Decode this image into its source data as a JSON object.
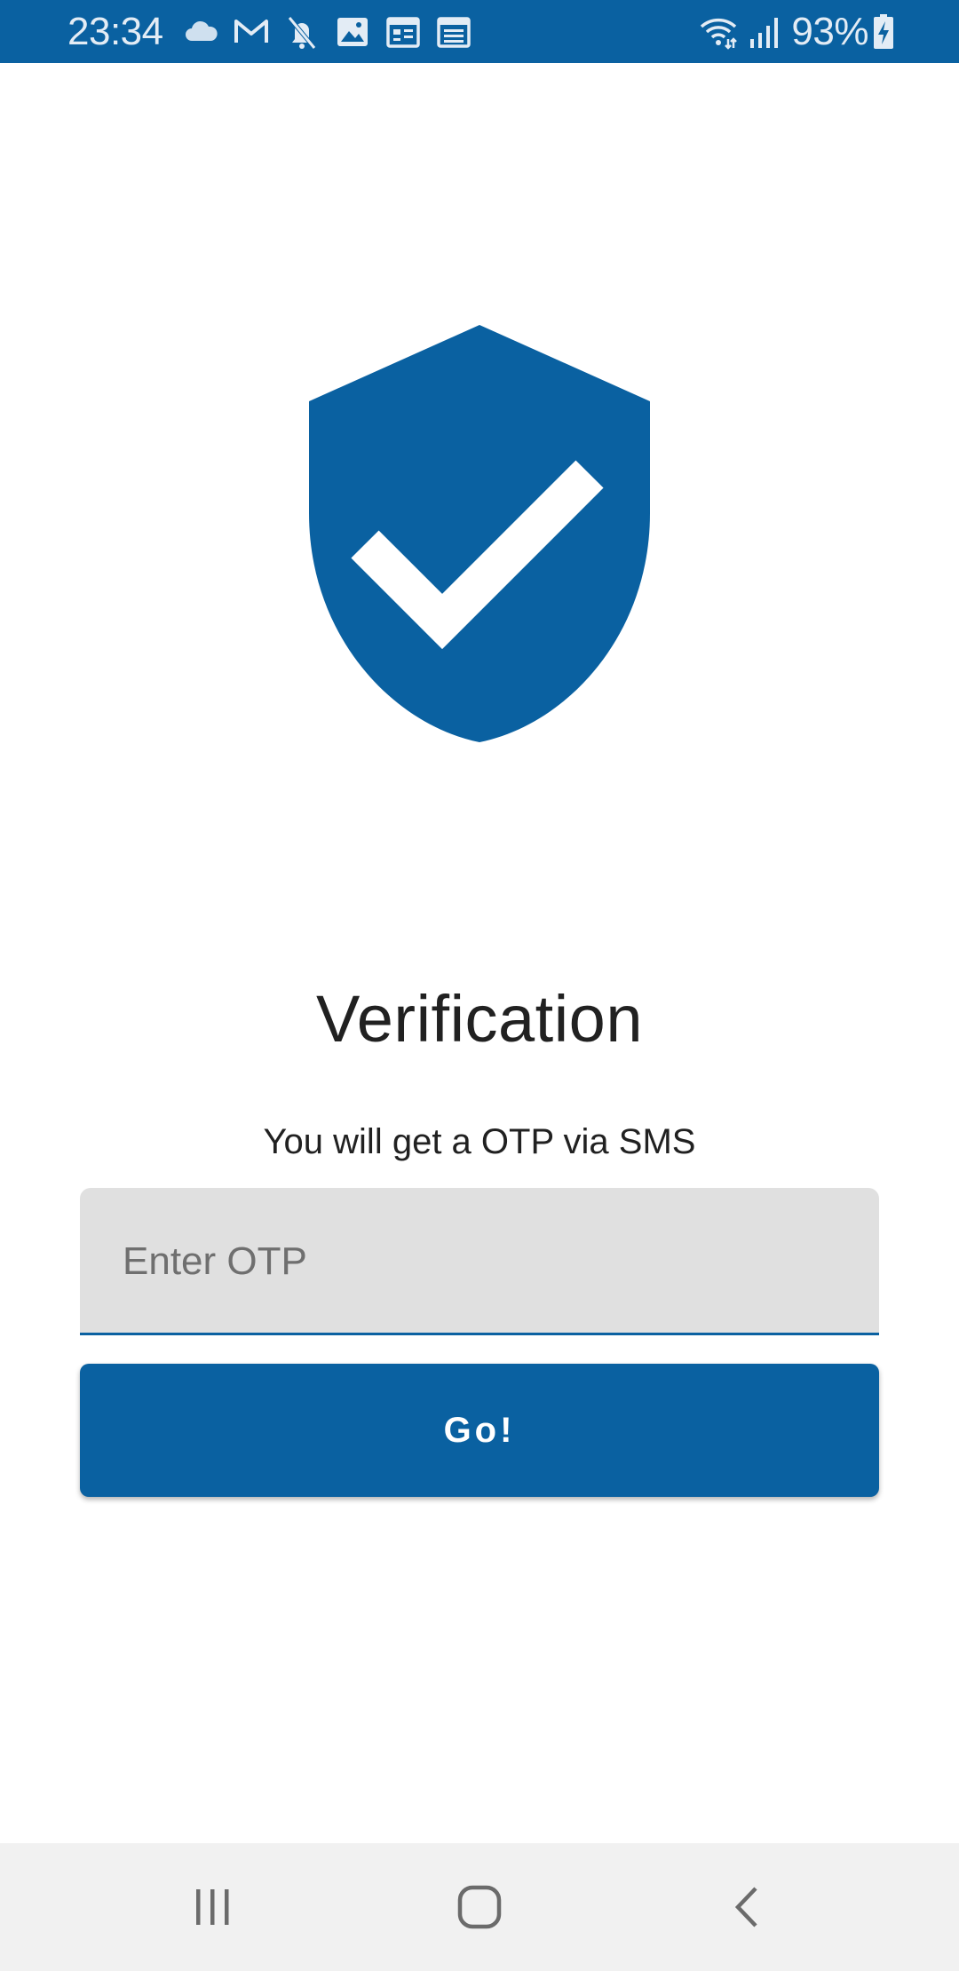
{
  "colors": {
    "accent": "#0a61a1",
    "status_bar": "#0a61a1",
    "field_bg": "#e0e0e0",
    "nav_bar_bg": "#f1f1f1",
    "text": "#212121"
  },
  "status_bar": {
    "time": "23:34",
    "left_icons": [
      "cloud-icon",
      "gmail-icon",
      "mute-icon",
      "image-icon",
      "calendar-icon",
      "calendar-icon"
    ],
    "right_icons": [
      "wifi-icon",
      "signal-icon",
      "battery-charging-icon"
    ],
    "battery_percent": "93%"
  },
  "hero": {
    "icon": "shield-check-icon"
  },
  "title": "Verification",
  "subtitle": "You will get a OTP via SMS",
  "otp_input": {
    "placeholder": "Enter OTP",
    "value": ""
  },
  "go_button": {
    "label": "Go!"
  },
  "nav_bar": {
    "buttons": [
      "recents-icon",
      "home-icon",
      "back-icon"
    ]
  }
}
